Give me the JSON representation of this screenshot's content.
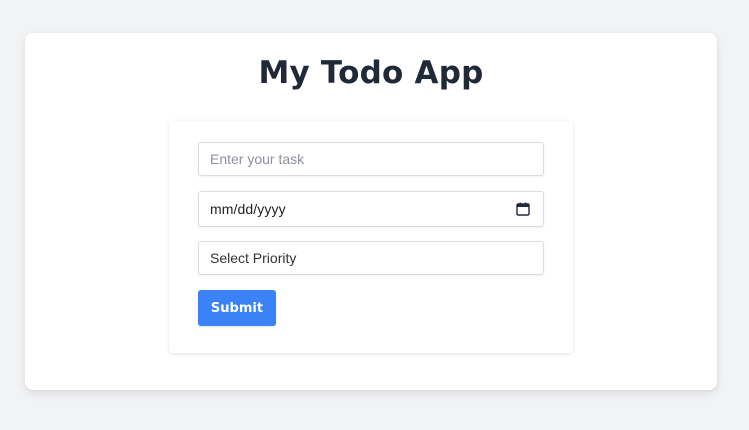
{
  "app": {
    "title": "My Todo App"
  },
  "form": {
    "task": {
      "value": "",
      "placeholder": "Enter your task"
    },
    "date": {
      "display": "mm/dd/yyyy",
      "icon": "calendar-icon"
    },
    "priority": {
      "selected": "Select Priority"
    },
    "submit_label": "Submit"
  },
  "colors": {
    "page_background": "#f2f3f5",
    "card_background": "#ffffff",
    "title_text": "#1f2937",
    "accent": "#3b82f6"
  }
}
